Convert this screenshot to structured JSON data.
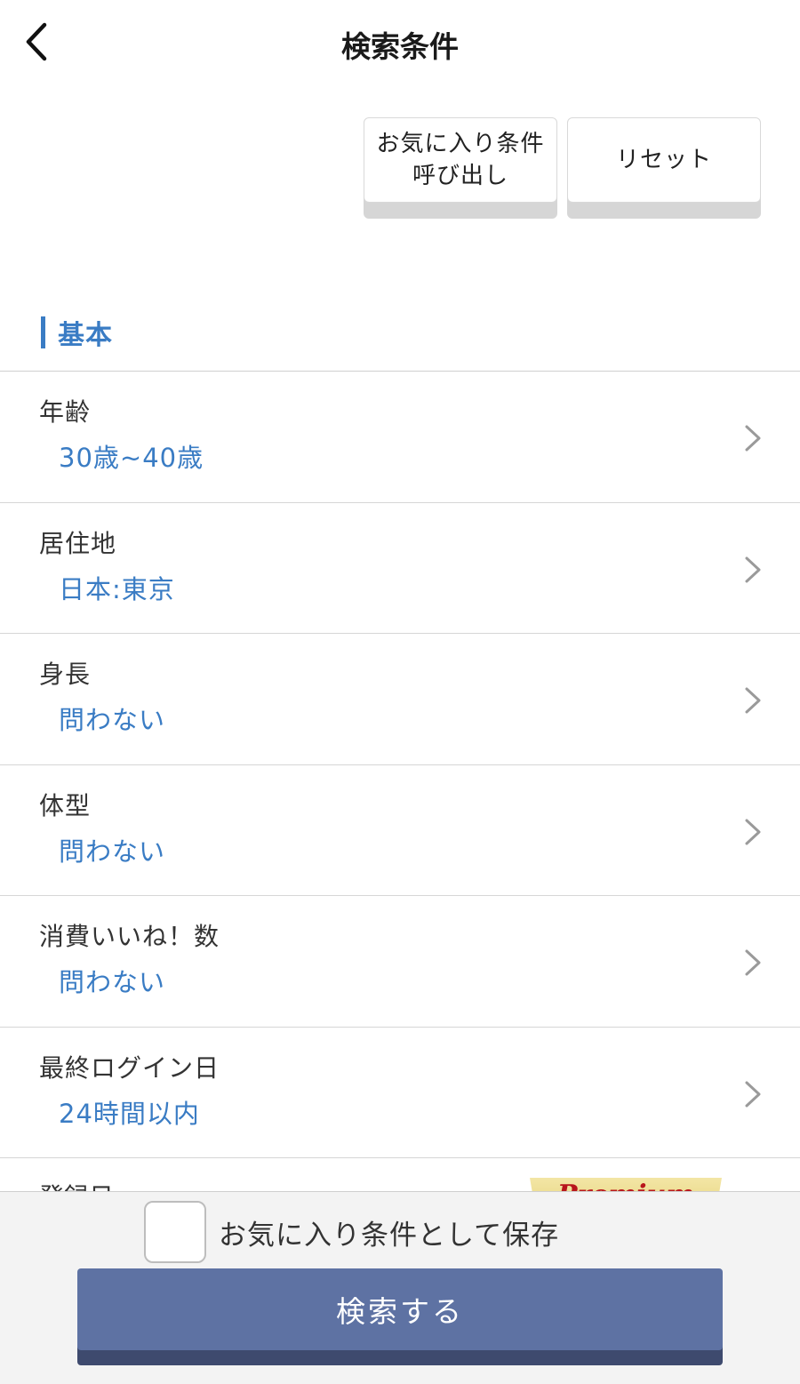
{
  "header": {
    "title": "検索条件",
    "back_icon": "chevron-left-icon"
  },
  "top_buttons": {
    "favorite_line1": "お気に入り条件",
    "favorite_line2": "呼び出し",
    "reset_label": "リセット"
  },
  "section": {
    "title": "基本"
  },
  "conditions": [
    {
      "label": "年齢",
      "value": "30歳~40歳"
    },
    {
      "label": "居住地",
      "value": "日本:東京"
    },
    {
      "label": "身長",
      "value": "問わない"
    },
    {
      "label": "体型",
      "value": "問わない"
    },
    {
      "label": "消費いいね！数",
      "value": "問わない"
    },
    {
      "label": "最終ログイン日",
      "value": "24時間以内"
    }
  ],
  "partial_row": {
    "label": "登録日",
    "badge": "Premium"
  },
  "footer": {
    "save_label": "お気に入り条件として保存",
    "save_checked": false,
    "search_label": "検索する"
  },
  "colors": {
    "accent_blue": "#3a7cc4",
    "search_button": "#5e72a3",
    "search_button_shadow": "#3e4a6e"
  }
}
